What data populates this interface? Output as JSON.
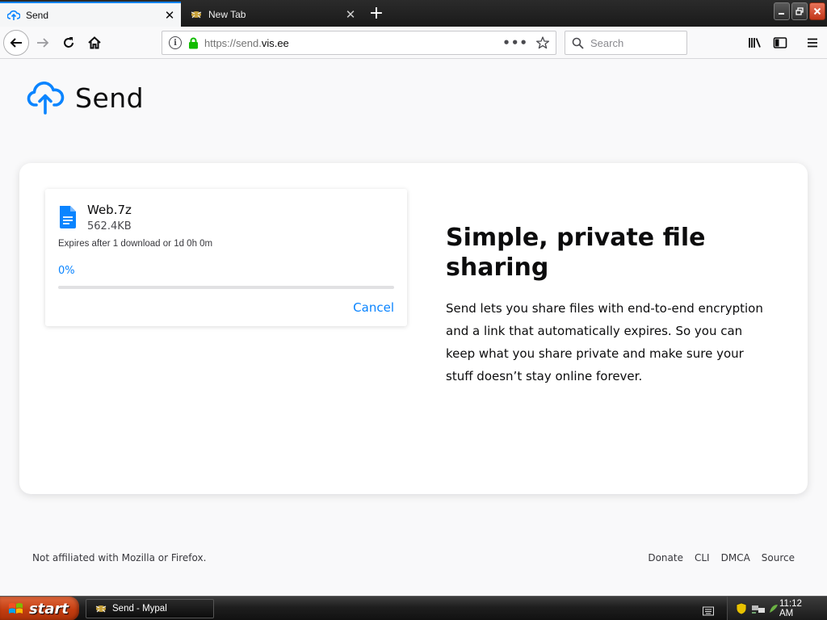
{
  "browser": {
    "tabs": [
      {
        "label": "Send",
        "active": true
      },
      {
        "label": "New Tab",
        "active": false
      }
    ],
    "new_tab_symbol": "+",
    "close_symbol": "✕",
    "url_prefix": "https://send.",
    "url_domain": "vis.ee",
    "search_placeholder": "Search",
    "more_symbol": "•••"
  },
  "page": {
    "brand_name": "Send",
    "upload": {
      "file_name": "Web.7z",
      "file_size": "562.4KB",
      "expires": "Expires after 1 download or 1d 0h 0m",
      "progress_text": "0%",
      "progress_value": 0,
      "cancel_label": "Cancel"
    },
    "intro": {
      "title": "Simple, private file sharing",
      "body": "Send lets you share files with end-to-end encryption and a link that automatically expires. So you can keep what you share private and make sure your stuff doesn’t stay online forever."
    },
    "footer": {
      "disclaimer": "Not affiliated with Mozilla or Firefox.",
      "links": [
        "Donate",
        "CLI",
        "DMCA",
        "Source"
      ]
    }
  },
  "taskbar": {
    "start_label": "start",
    "task_label": "Send - Mypal",
    "clock": "11:12 AM"
  },
  "colors": {
    "accent": "#0a84ff",
    "text": "#0c0c0d"
  }
}
